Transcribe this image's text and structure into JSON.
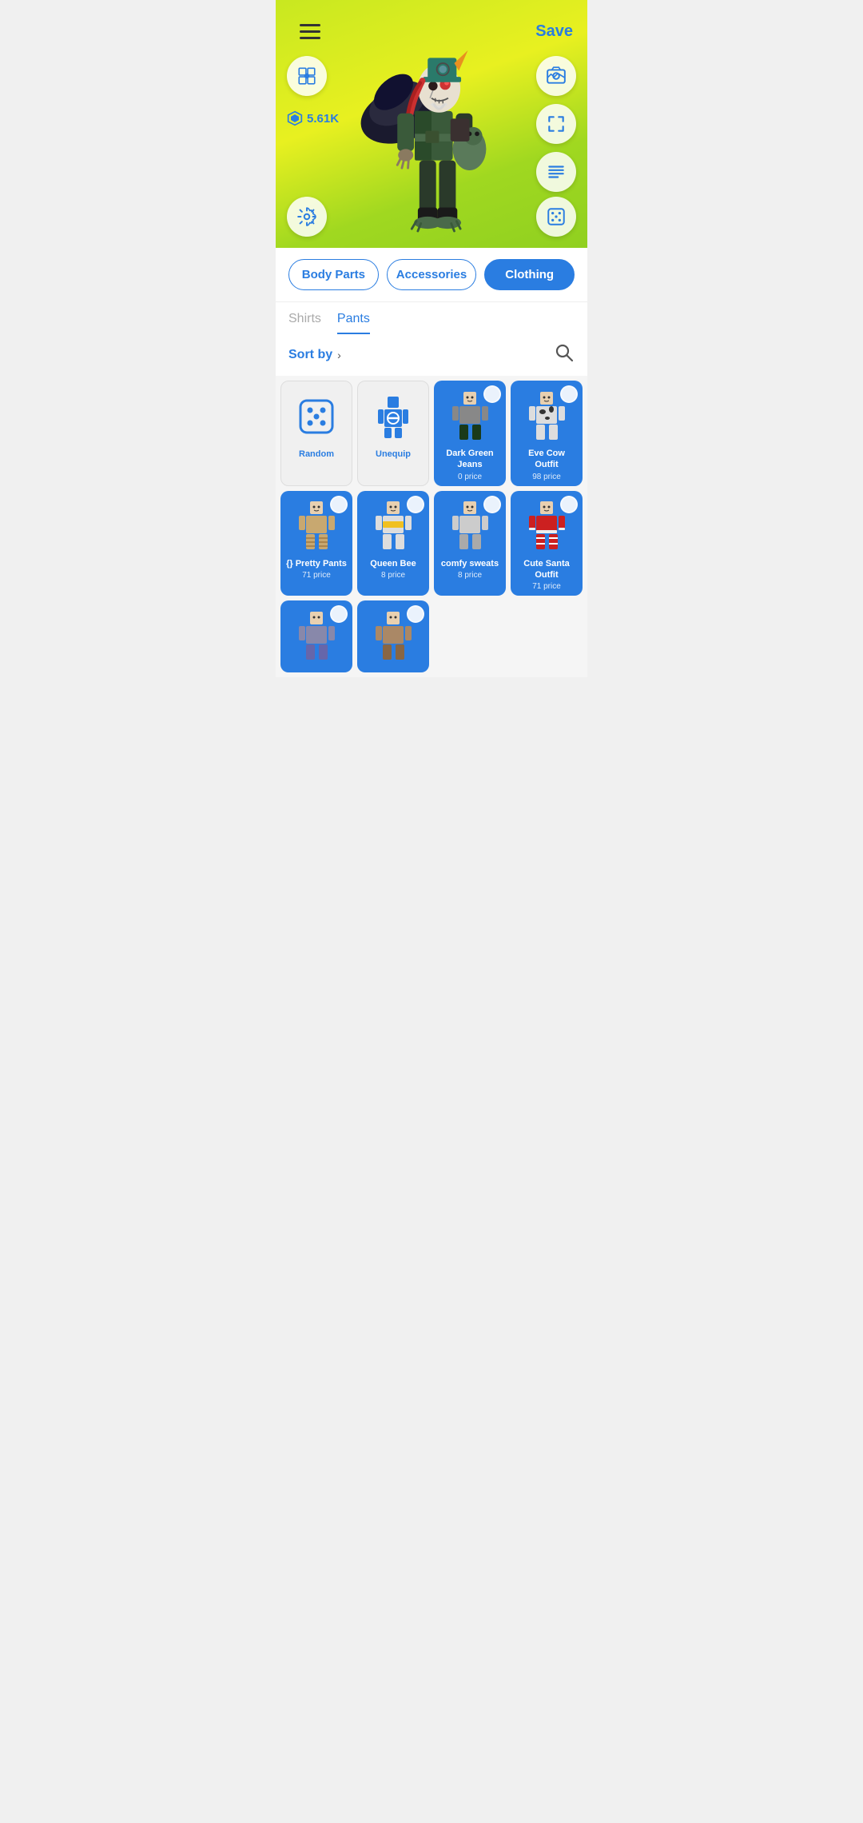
{
  "header": {
    "save_label": "Save",
    "robux_amount": "5.61K"
  },
  "category_tabs": [
    {
      "id": "body_parts",
      "label": "Body Parts",
      "active": false
    },
    {
      "id": "accessories",
      "label": "Accessories",
      "active": false
    },
    {
      "id": "clothing",
      "label": "Clothing",
      "active": true
    }
  ],
  "sub_tabs": [
    {
      "id": "shirts",
      "label": "Shirts",
      "active": false
    },
    {
      "id": "pants",
      "label": "Pants",
      "active": true
    }
  ],
  "sort": {
    "label": "Sort by",
    "arrow": "›"
  },
  "items": [
    {
      "id": "random",
      "label": "Random",
      "price": "",
      "type": "special",
      "bg": "white"
    },
    {
      "id": "unequip",
      "label": "Unequip",
      "price": "",
      "type": "special",
      "bg": "white"
    },
    {
      "id": "dark_green_jeans",
      "label": "Dark Green Jeans",
      "price": "0 price",
      "bg": "blue"
    },
    {
      "id": "eve_cow_outfit",
      "label": "Eve Cow Outfit",
      "price": "98 price",
      "bg": "blue"
    },
    {
      "id": "pretty_pants",
      "label": "{} Pretty Pants",
      "price": "71 price",
      "bg": "blue"
    },
    {
      "id": "queen_bee",
      "label": "Queen Bee",
      "price": "8 price",
      "bg": "blue"
    },
    {
      "id": "comfy_sweats",
      "label": "comfy sweats",
      "price": "8 price",
      "bg": "blue"
    },
    {
      "id": "cute_santa",
      "label": "Cute Santa Outfit",
      "price": "71 price",
      "bg": "blue"
    }
  ],
  "icons": {
    "hamburger": "☰",
    "robux_symbol": "⬡",
    "search": "⌕",
    "sort_arrow": "›"
  }
}
